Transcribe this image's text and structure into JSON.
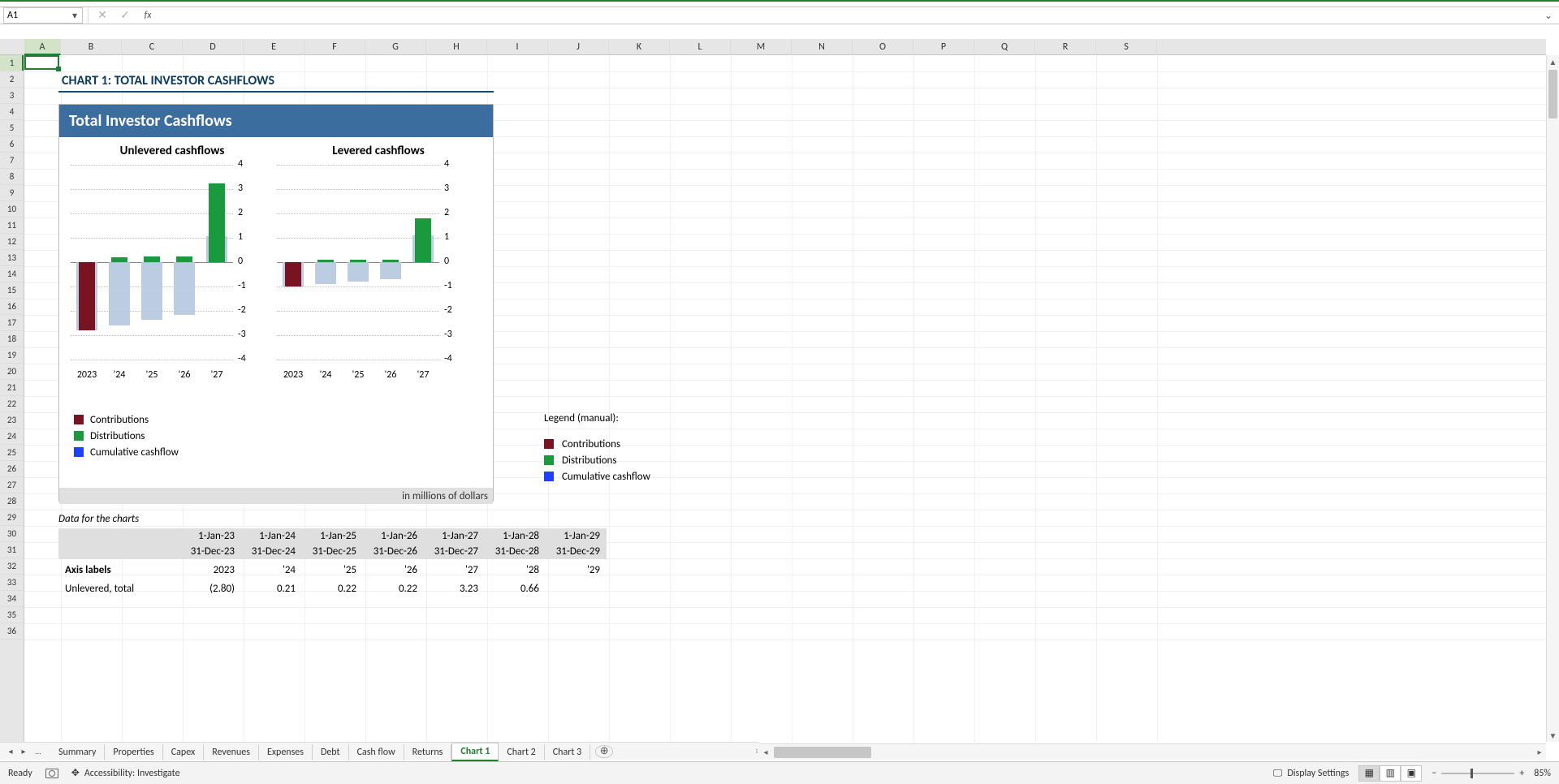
{
  "name_box": "A1",
  "formula_value": "",
  "columns": [
    "A",
    "B",
    "C",
    "D",
    "E",
    "F",
    "G",
    "H",
    "I",
    "J",
    "K",
    "L",
    "M",
    "N",
    "O",
    "P",
    "Q",
    "R",
    "S"
  ],
  "rows": [
    "1",
    "2",
    "3",
    "4",
    "5",
    "6",
    "7",
    "8",
    "9",
    "10",
    "11",
    "12",
    "13",
    "14",
    "15",
    "16",
    "17",
    "18",
    "19",
    "20",
    "21",
    "22",
    "23",
    "24",
    "25",
    "26",
    "27",
    "28",
    "29",
    "30",
    "31",
    "32",
    "33",
    "34",
    "35",
    "36"
  ],
  "sheet_tabs": [
    "Summary",
    "Properties",
    "Capex",
    "Revenues",
    "Expenses",
    "Debt",
    "Cash flow",
    "Returns",
    "Chart 1",
    "Chart 2",
    "Chart 3"
  ],
  "active_tab": "Chart 1",
  "status_ready": "Ready",
  "status_accessibility": "Accessibility: Investigate",
  "display_settings": "Display Settings",
  "zoom_label": "85%",
  "chart_section_title": "CHART 1: TOTAL INVESTOR CASHFLOWS",
  "chart_header": "Total Investor Cashflows",
  "sub1_title": "Unlevered cashflows",
  "sub2_title": "Levered cashflows",
  "legend": {
    "contrib": "Contributions",
    "distrib": "Distributions",
    "cum": "Cumulative cashflow"
  },
  "chart_footer": "in millions of dollars",
  "manual_legend_header": "Legend (manual):",
  "data_caption": "Data for the charts",
  "data_headers_top": [
    "",
    "1-Jan-23",
    "1-Jan-24",
    "1-Jan-25",
    "1-Jan-26",
    "1-Jan-27",
    "1-Jan-28",
    "1-Jan-29"
  ],
  "data_headers_bot": [
    "",
    "31-Dec-23",
    "31-Dec-24",
    "31-Dec-25",
    "31-Dec-26",
    "31-Dec-27",
    "31-Dec-28",
    "31-Dec-29"
  ],
  "axis_row": [
    "Axis labels",
    "2023",
    "'24",
    "'25",
    "'26",
    "'27",
    "'28",
    "'29"
  ],
  "unlevered_row": [
    "Unlevered, total",
    "(2.80)",
    "0.21",
    "0.22",
    "0.22",
    "3.23",
    "0.66",
    ""
  ],
  "chart_data": [
    {
      "type": "bar_area_combo",
      "title": "Unlevered cashflows",
      "categories": [
        "2023",
        "'24",
        "'25",
        "'26",
        "'27"
      ],
      "ylim": [
        -4,
        4
      ],
      "yticks": [
        -4,
        -3,
        -2,
        -1,
        0,
        1,
        2,
        3,
        4
      ],
      "series": [
        {
          "name": "Contributions",
          "values": [
            -2.8,
            0,
            0,
            0,
            0
          ]
        },
        {
          "name": "Distributions",
          "values": [
            0,
            0.21,
            0.22,
            0.22,
            3.23
          ]
        },
        {
          "name": "Cumulative cashflow",
          "values": [
            -2.8,
            -2.59,
            -2.37,
            -2.15,
            1.08
          ]
        }
      ]
    },
    {
      "type": "bar_area_combo",
      "title": "Levered cashflows",
      "categories": [
        "2023",
        "'24",
        "'25",
        "'26",
        "'27"
      ],
      "ylim": [
        -4,
        4
      ],
      "yticks": [
        -4,
        -3,
        -2,
        -1,
        0,
        1,
        2,
        3,
        4
      ],
      "series": [
        {
          "name": "Contributions",
          "values": [
            -1.0,
            0,
            0,
            0,
            0
          ]
        },
        {
          "name": "Distributions",
          "values": [
            0,
            0.1,
            0.1,
            0.1,
            1.8
          ]
        },
        {
          "name": "Cumulative cashflow",
          "values": [
            -1.0,
            -0.9,
            -0.8,
            -0.7,
            1.1
          ]
        }
      ]
    }
  ]
}
